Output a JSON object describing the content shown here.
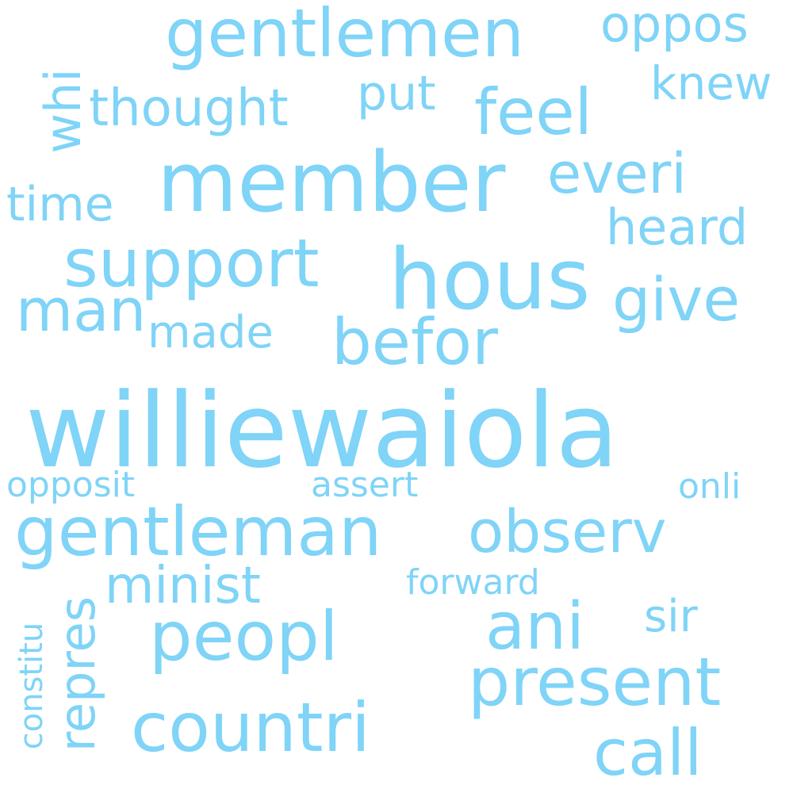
{
  "word_color": "#7fd4f7",
  "background": "#ffffff",
  "words": {
    "williewaiola": "williewaiola",
    "member": "member",
    "hous": "hous",
    "gentleman": "gentleman",
    "gentlemen": "gentlemen",
    "support": "support",
    "peopl": "peopl",
    "countri": "countri",
    "present": "present",
    "befor": "befor",
    "ani": "ani",
    "give": "give",
    "call": "call",
    "feel": "feel",
    "observ": "observ",
    "man": "man",
    "everi": "everi",
    "thought": "thought",
    "whi": "whi",
    "oppos": "oppos",
    "heard": "heard",
    "repres": "repres",
    "put": "put",
    "knew": "knew",
    "minist": "minist",
    "time": "time",
    "made": "made",
    "sir": "sir",
    "opposit": "opposit",
    "assert": "assert",
    "onli": "onli",
    "forward": "forward",
    "constitu": "constitu"
  }
}
